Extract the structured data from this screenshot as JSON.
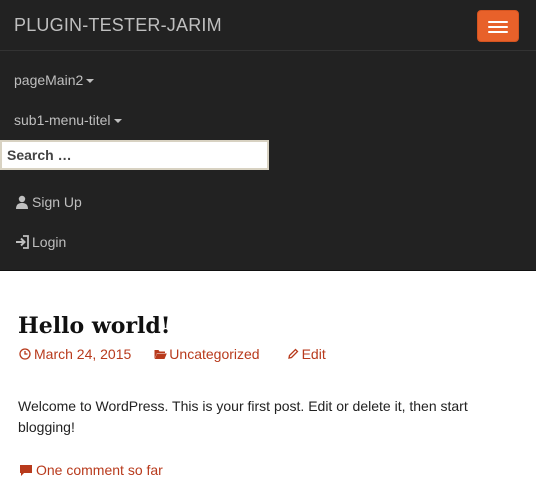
{
  "navbar": {
    "brand": "PLUGIN-TESTER-JARIM",
    "toggle_icon": "hamburger-icon",
    "accent_color": "#e8612a",
    "background_color": "#222222",
    "menu": [
      {
        "label": "pageMain2",
        "has_dropdown": true
      },
      {
        "label": "sub1-menu-titel",
        "has_dropdown": true
      }
    ],
    "search": {
      "placeholder": "Search …",
      "value": ""
    },
    "signup": {
      "label": "Sign Up",
      "icon": "user-icon"
    },
    "login": {
      "label": "Login",
      "icon": "login-icon"
    }
  },
  "post": {
    "title": "Hello world!",
    "date": "March 24, 2015",
    "date_icon": "clock-icon",
    "category": "Uncategorized",
    "category_icon": "folder-icon",
    "edit_label": "Edit",
    "edit_icon": "pencil-icon",
    "body": "Welcome to WordPress. This is your first post. Edit or delete it, then start blogging!",
    "comments_label": "One comment so far",
    "comments_icon": "comment-icon",
    "link_color": "#b83a1c"
  }
}
